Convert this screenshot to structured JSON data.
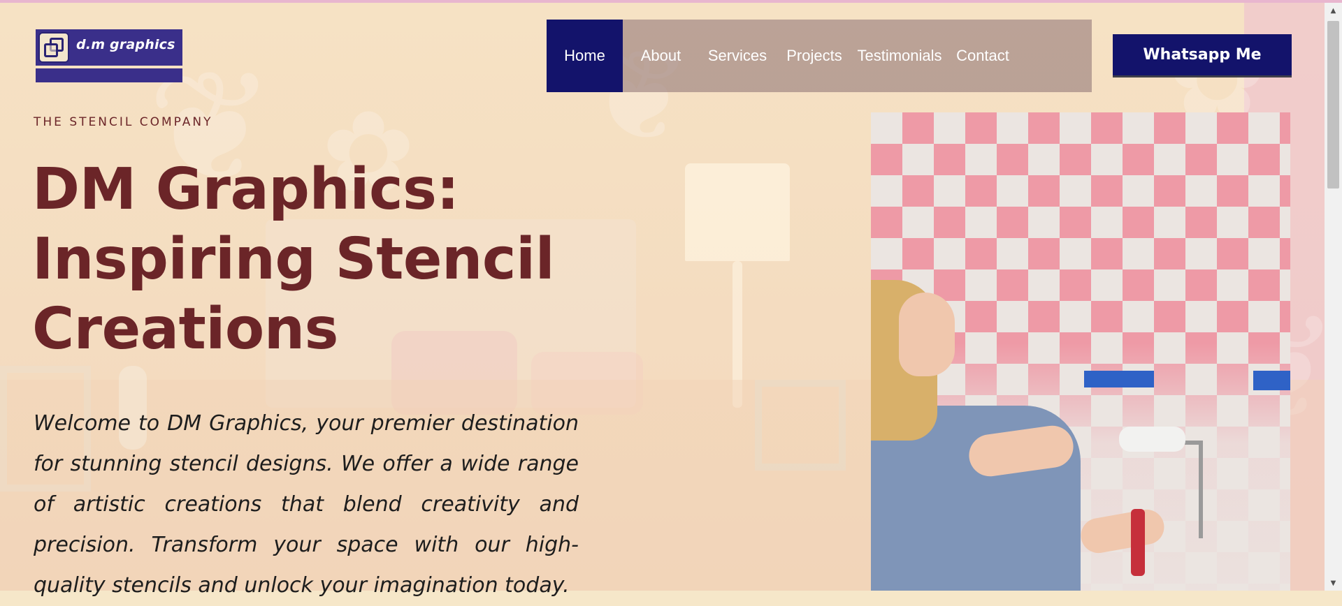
{
  "brand": {
    "logo_text": "d.m graphics"
  },
  "nav": {
    "items": [
      {
        "label": "Home",
        "active": true
      },
      {
        "label": "About",
        "active": false
      },
      {
        "label": "Services",
        "active": false
      },
      {
        "label": "Projects",
        "active": false
      },
      {
        "label": "Testimonials",
        "active": false
      },
      {
        "label": "Contact",
        "active": false
      }
    ]
  },
  "cta": {
    "whatsapp_label": "Whatsapp Me"
  },
  "hero": {
    "kicker": "THE STENCIL COMPANY",
    "title_line1": "DM Graphics:",
    "title_line2": "Inspiring Stencil",
    "title_line3": "Creations",
    "intro": "Welcome to DM Graphics, your premier destination for stunning stencil designs. We offer a wide range of artistic creations that blend creativity and precision. Transform your space with our high-quality stencils and unlock your imagination today."
  },
  "colors": {
    "accent_navy": "#13136b",
    "headline_maroon": "#6b2528",
    "logo_purple": "#3a2f8a",
    "nav_overlay": "#967a7a",
    "stencil_pink": "#ee9aa6",
    "tape_blue": "#2f62c6"
  },
  "icons": {
    "logo_mark": "overlapping-squares-icon",
    "scroll_up": "chevron-up-icon",
    "scroll_down": "chevron-down-icon"
  }
}
